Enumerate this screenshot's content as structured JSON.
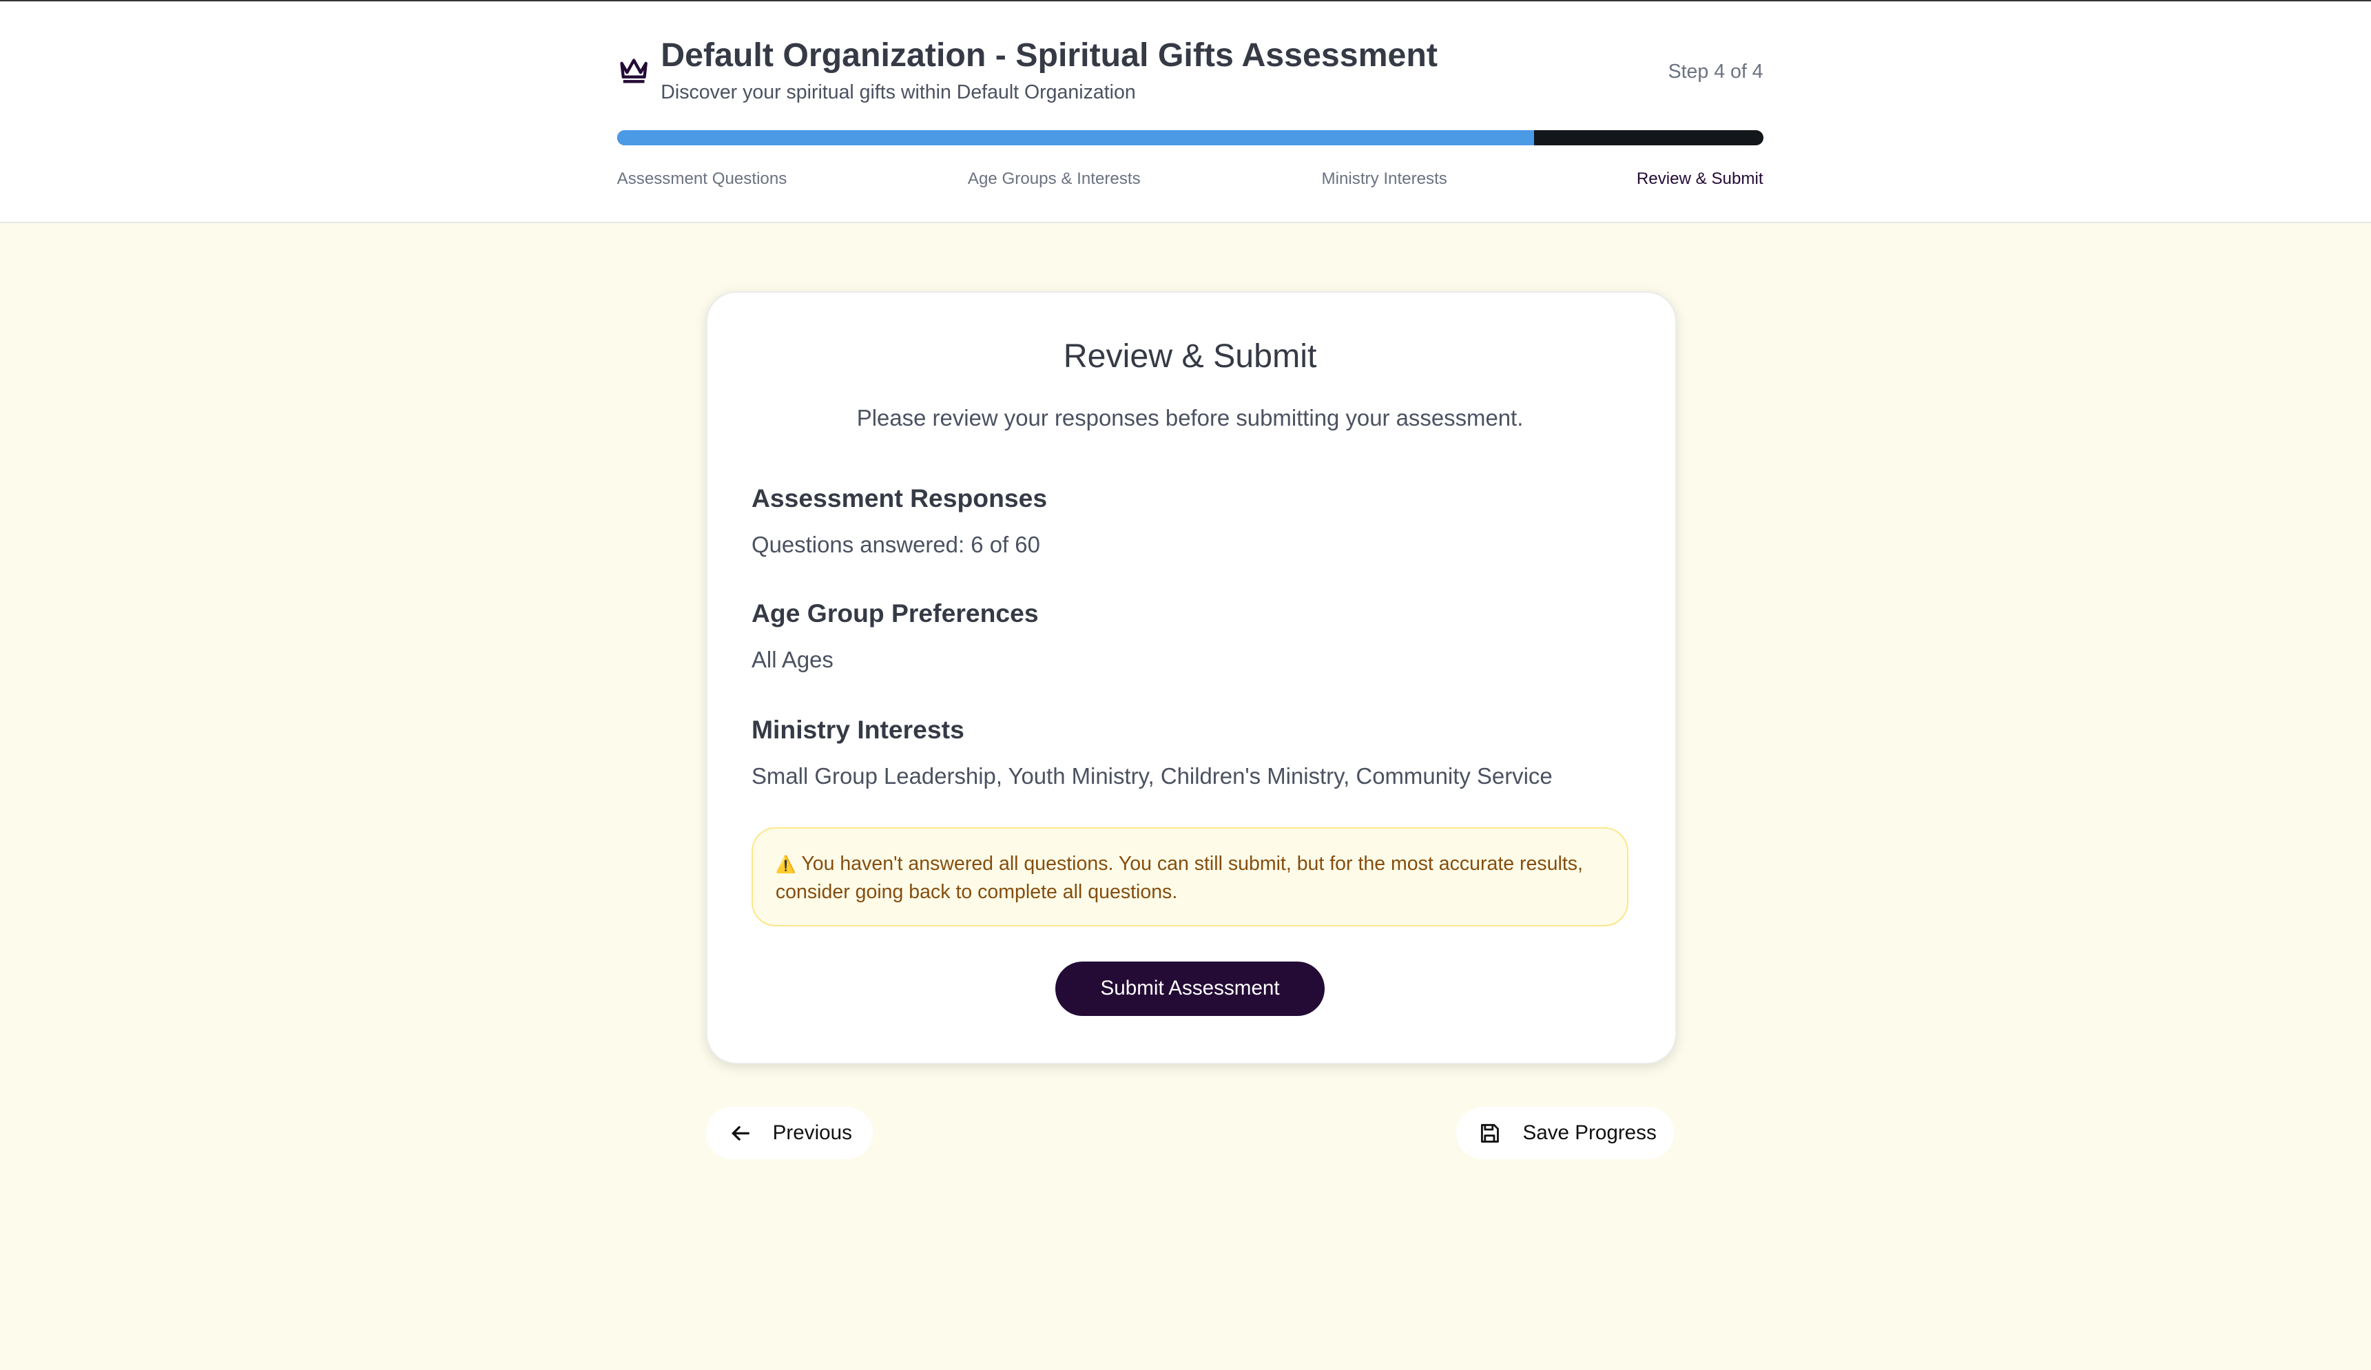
{
  "header": {
    "title": "Default Organization - Spiritual Gifts Assessment",
    "subtitle": "Discover your spiritual gifts within Default Organization",
    "step": "Step 4 of 4",
    "progress_percent": 80,
    "colors": {
      "progress_fill": "#4a9ae6",
      "progress_track": "#13161a"
    },
    "steps": [
      "Assessment Questions",
      "Age Groups & Interests",
      "Ministry Interests",
      "Review & Submit"
    ],
    "active_step": 3
  },
  "card": {
    "title": "Review & Submit",
    "description": "Please review your responses before submitting your assessment.",
    "sections": [
      {
        "heading": "Assessment Responses",
        "text": "Questions answered: 6 of 60"
      },
      {
        "heading": "Age Group Preferences",
        "text": "All Ages"
      },
      {
        "heading": "Ministry Interests",
        "text": "Small Group Leadership, Youth Ministry, Children's Ministry, Community Service"
      }
    ],
    "warning_icon": "⚠️",
    "warning": "You haven't answered all questions. You can still submit, but for the most accurate results, consider going back to complete all questions.",
    "submit_label": "Submit Assessment",
    "accent": "#240b36"
  },
  "nav": {
    "previous_label": "Previous",
    "save_label": "Save Progress"
  }
}
